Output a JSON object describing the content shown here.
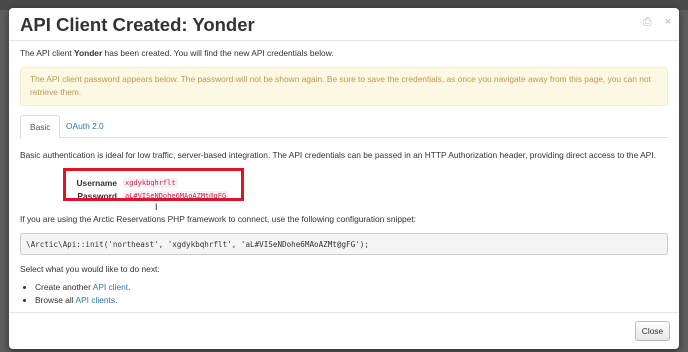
{
  "modal": {
    "title": "API Client Created: Yonder",
    "intro_before": "The API client ",
    "client_name": "Yonder",
    "intro_after": " has been created. You will find the new API credentials below.",
    "alert": "The API client password appears below. The password will not be shown again. Be sure to save the credentials, as once you navigate away from this page, you can not retrieve them."
  },
  "tabs": [
    {
      "label": "Basic",
      "active": true
    },
    {
      "label": "OAuth 2.0",
      "active": false
    }
  ],
  "basic": {
    "description": "Basic authentication is ideal for low traffic, server-based integration. The API credentials can be passed in an HTTP Authorization header, providing direct access to the API.",
    "username_label": "Username",
    "username_value": "xgdykbqhrflt",
    "password_label": "Password",
    "password_value": "aL#VISeNDohe6MAoAZMt@gFG",
    "snippet_intro": "If you are using the Arctic Reservations PHP framework to connect, use the following configuration snippet:",
    "code": "\\Arctic\\Api::init('northeast', 'xgdykbqhrflt', 'aL#VISeNDohe6MAoAZMt@gFG');"
  },
  "next": {
    "intro": "Select what you would like to do next:",
    "items": [
      {
        "prefix": "Create another ",
        "link": "API client",
        "suffix": "."
      },
      {
        "prefix": "Browse all ",
        "link": "API clients",
        "suffix": "."
      }
    ]
  },
  "footer": {
    "close_label": "Close"
  },
  "icons": {
    "header": [
      "print-icon",
      "close-icon"
    ]
  },
  "colors": {
    "link": "#2a7ab0",
    "alert_text": "#c09853",
    "highlight_box": "#e0141e"
  }
}
